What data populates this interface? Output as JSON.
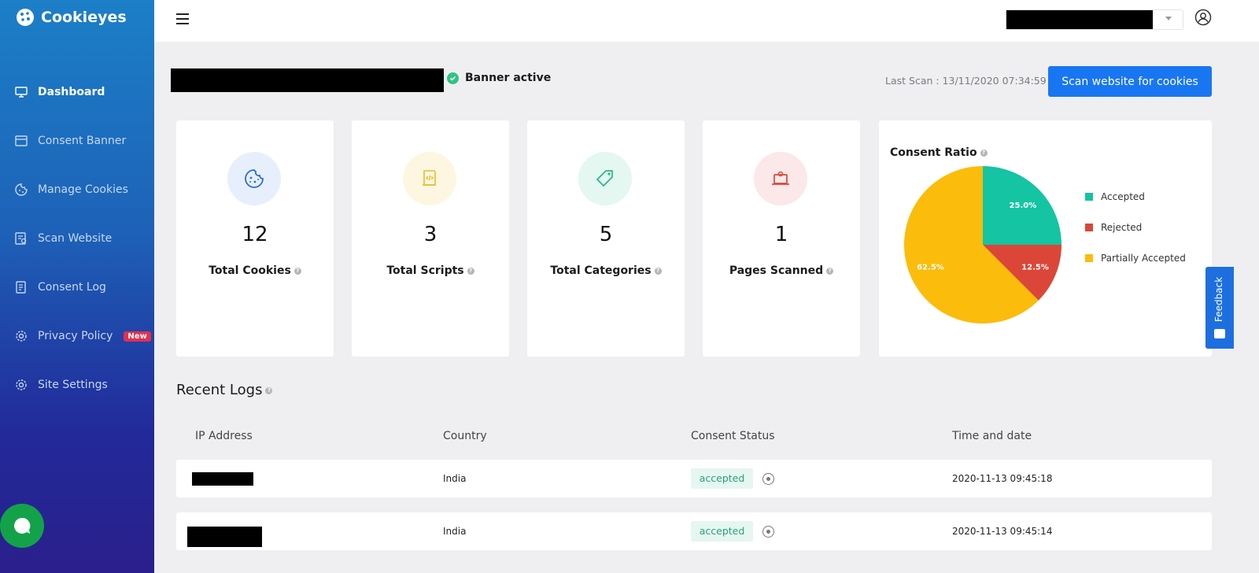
{
  "app": {
    "name": "Cookieyes"
  },
  "sidebar": {
    "items": [
      {
        "label": "Dashboard",
        "icon": "monitor-icon",
        "active": true
      },
      {
        "label": "Consent Banner",
        "icon": "banner-icon"
      },
      {
        "label": "Manage Cookies",
        "icon": "cookie-icon"
      },
      {
        "label": "Scan Website",
        "icon": "scan-icon"
      },
      {
        "label": "Consent Log",
        "icon": "log-icon"
      },
      {
        "label": "Privacy Policy",
        "icon": "gear-icon",
        "badge": "New"
      },
      {
        "label": "Site Settings",
        "icon": "gear-icon"
      }
    ]
  },
  "header": {
    "banner_status": "Banner active",
    "last_scan": "Last Scan : 13/11/2020 07:34:59",
    "scan_button": "Scan website for cookies"
  },
  "stats": [
    {
      "value": "12",
      "label": "Total Cookies",
      "icon": "cookie-icon",
      "bg": "#e8effc",
      "fg": "#2a6fd6"
    },
    {
      "value": "3",
      "label": "Total Scripts",
      "icon": "script-icon",
      "bg": "#fdf7e2",
      "fg": "#e7bb2a"
    },
    {
      "value": "5",
      "label": "Total Categories",
      "icon": "tag-icon",
      "bg": "#e4f7f1",
      "fg": "#2bb58b"
    },
    {
      "value": "1",
      "label": "Pages Scanned",
      "icon": "laptop-icon",
      "bg": "#fce8e8",
      "fg": "#d9483b"
    }
  ],
  "consent_ratio": {
    "title": "Consent Ratio",
    "slices": [
      {
        "label": "Accepted",
        "value": 25.0,
        "display": "25.0%",
        "color": "#14c4a2"
      },
      {
        "label": "Rejected",
        "value": 12.5,
        "display": "12.5%",
        "color": "#dc4638"
      },
      {
        "label": "Partially Accepted",
        "value": 62.5,
        "display": "62.5%",
        "color": "#fbbc0b"
      }
    ]
  },
  "feedback": {
    "label": "Feedback"
  },
  "logs": {
    "title": "Recent Logs",
    "columns": [
      "IP Address",
      "Country",
      "Consent Status",
      "Time and date"
    ],
    "rows": [
      {
        "country": "India",
        "status": "accepted",
        "time": "2020-11-13 09:45:18"
      },
      {
        "country": "India",
        "status": "accepted",
        "time": "2020-11-13 09:45:14"
      }
    ]
  }
}
